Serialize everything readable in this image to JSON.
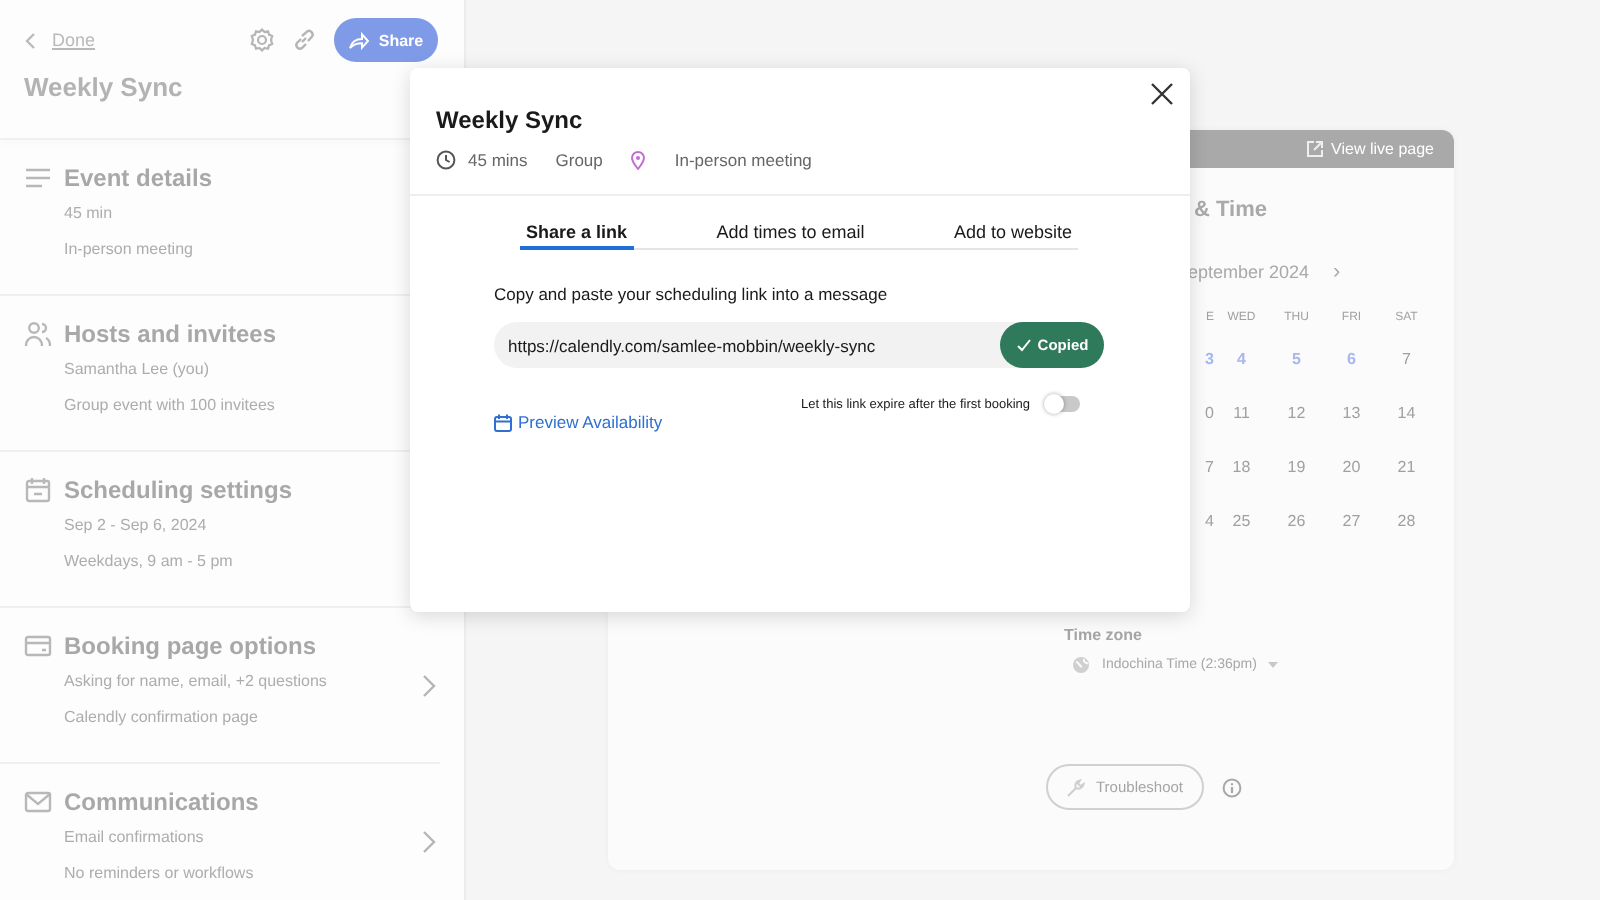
{
  "sidebar": {
    "back_link": "Done",
    "share_button": "Share",
    "title": "Weekly Sync",
    "sections": [
      {
        "title": "Event details",
        "lines": [
          "45 min",
          "In-person meeting"
        ]
      },
      {
        "title": "Hosts and invitees",
        "lines": [
          "Samantha Lee (you)",
          "Group event with 100 invitees"
        ]
      },
      {
        "title": "Scheduling settings",
        "lines": [
          "Sep 2 - Sep 6, 2024",
          "Weekdays, 9 am - 5 pm"
        ]
      },
      {
        "title": "Booking page options",
        "lines": [
          "Asking for name, email, +2 questions",
          "Calendly confirmation page"
        ],
        "navigable": true
      },
      {
        "title": "Communications",
        "lines": [
          "Email confirmations",
          "No reminders or workflows"
        ],
        "navigable": true
      }
    ]
  },
  "preview": {
    "view_live": "View live page",
    "heading": "& Time",
    "month": "eptember 2024",
    "next": "›",
    "weekdays": [
      "E",
      "WED",
      "THU",
      "FRI",
      "SAT"
    ],
    "weeks": [
      [
        {
          "day": "3",
          "available": true
        },
        {
          "day": "4",
          "available": true
        },
        {
          "day": "5",
          "available": true
        },
        {
          "day": "6",
          "available": true
        },
        {
          "day": "7",
          "available": false
        }
      ],
      [
        {
          "day": "0",
          "available": false
        },
        {
          "day": "11",
          "available": false
        },
        {
          "day": "12",
          "available": false
        },
        {
          "day": "13",
          "available": false
        },
        {
          "day": "14",
          "available": false
        }
      ],
      [
        {
          "day": "7",
          "available": false
        },
        {
          "day": "18",
          "available": false
        },
        {
          "day": "19",
          "available": false
        },
        {
          "day": "20",
          "available": false
        },
        {
          "day": "21",
          "available": false
        }
      ],
      [
        {
          "day": "4",
          "available": false
        },
        {
          "day": "25",
          "available": false
        },
        {
          "day": "26",
          "available": false
        },
        {
          "day": "27",
          "available": false
        },
        {
          "day": "28",
          "available": false
        }
      ]
    ],
    "time_zone_label": "Time zone",
    "time_zone": "Indochina Time (2:36pm)",
    "troubleshoot": "Troubleshoot"
  },
  "modal": {
    "title": "Weekly Sync",
    "duration": "45 mins",
    "type": "Group",
    "location": "In-person meeting",
    "tabs": [
      {
        "label": "Share a link",
        "selected": true
      },
      {
        "label": "Add times to email",
        "selected": false
      },
      {
        "label": "Add to website",
        "selected": false
      }
    ],
    "instruction": "Copy and paste your scheduling link into a message",
    "link": "https://calendly.com/samlee-mobbin/weekly-sync",
    "copy_button": "Copied",
    "expire_label": "Let this link expire after the first booking",
    "expire_on": false,
    "preview_link": "Preview Availability"
  }
}
